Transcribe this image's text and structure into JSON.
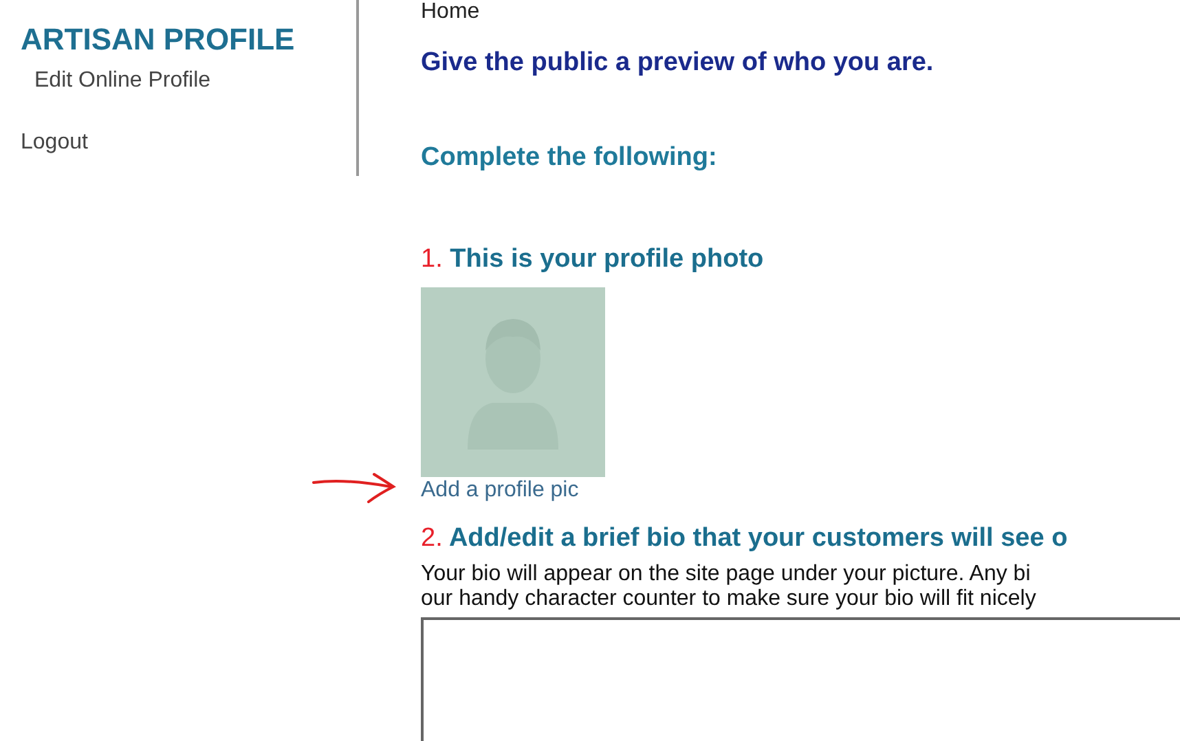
{
  "sidebar": {
    "title": "ARTISAN PROFILE",
    "items": [
      {
        "label": "Edit Online Profile",
        "kind": "subitem"
      },
      {
        "label": "Logout",
        "kind": "item"
      }
    ]
  },
  "breadcrumb": "Home",
  "heading": "Give the public a preview of who you are.",
  "subheading": "Complete the following:",
  "sections": [
    {
      "number": "1.",
      "title": "This is your profile photo",
      "kind": "photo",
      "link": "Add a profile pic",
      "arrow_annotation": true
    },
    {
      "number": "2.",
      "title": "Add/edit a brief bio that your customers will see o",
      "kind": "bio",
      "description_lines": [
        "Your bio will appear on the site page under your picture. Any bi",
        "our handy character counter to make sure your bio will fit nicely"
      ]
    }
  ]
}
